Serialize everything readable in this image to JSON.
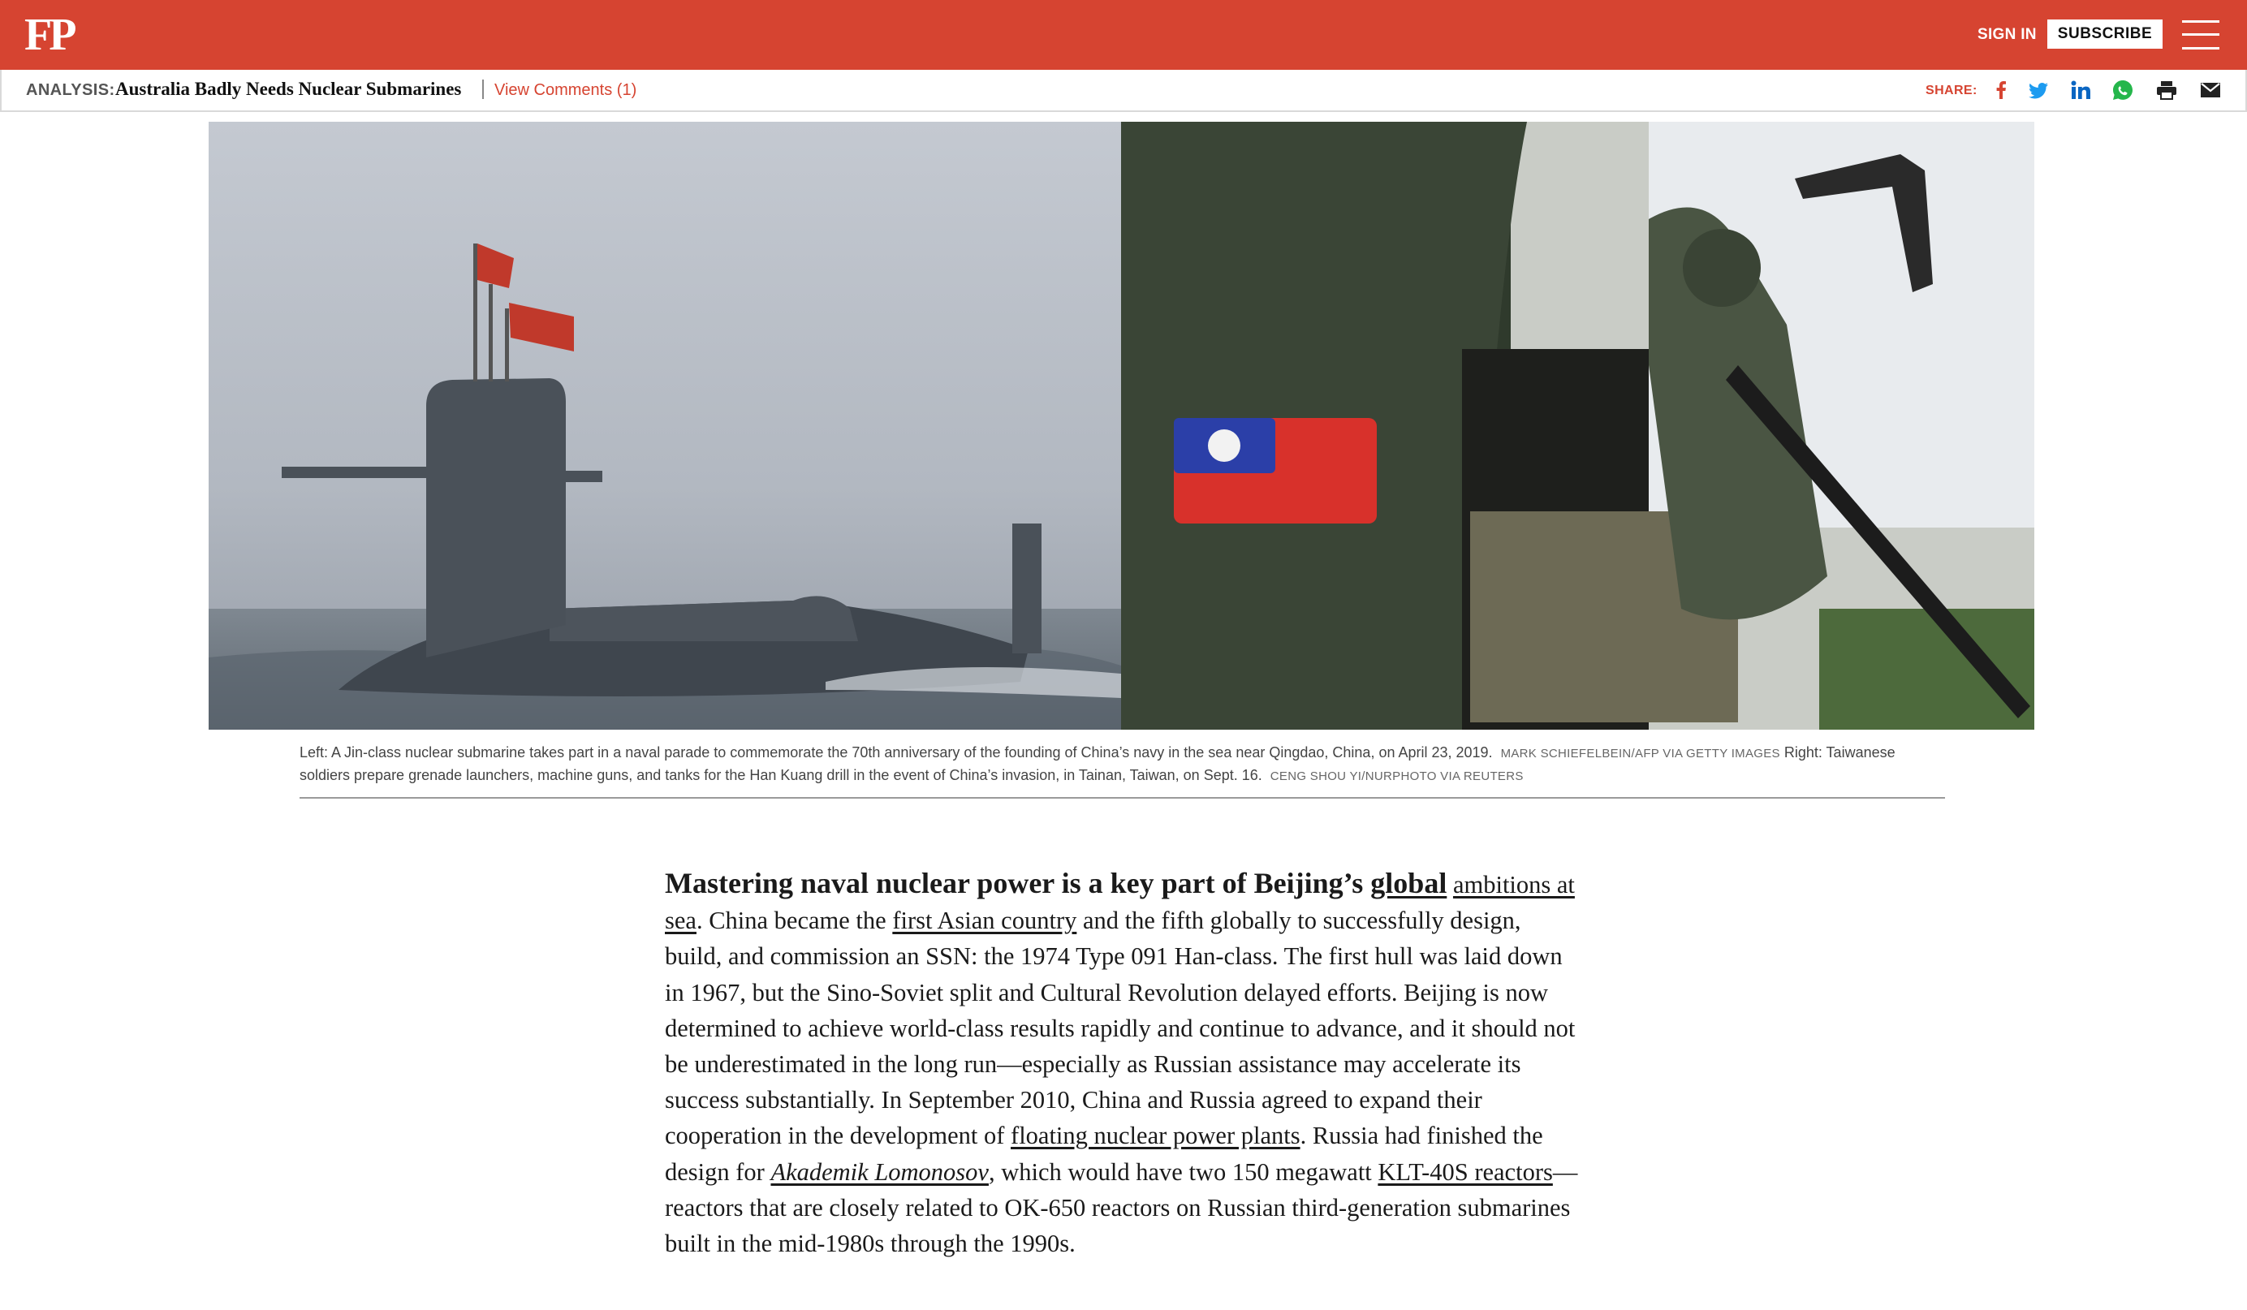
{
  "header": {
    "logo": "FP",
    "sign_in": "SIGN IN",
    "subscribe": "SUBSCRIBE",
    "brand_color": "#d64431"
  },
  "subbar": {
    "label": "ANALYSIS:",
    "title": "Australia Badly Needs Nuclear Submarines",
    "comments": "View Comments (1)",
    "share_label": "SHARE:",
    "share_icons": [
      "facebook-icon",
      "twitter-icon",
      "linkedin-icon",
      "whatsapp-icon",
      "print-icon",
      "email-icon"
    ]
  },
  "hero": {
    "left_image": "submarine-photo",
    "right_image": "soldiers-photo"
  },
  "caption": {
    "left_text": "Left: A Jin-class nuclear submarine takes part in a naval parade to commemorate the 70th anniversary of the founding of China’s navy in the sea near Qingdao, China, on April 23, 2019.",
    "left_credit": "MARK SCHIEFELBEIN/AFP VIA GETTY IMAGES",
    "right_text": "Right: Taiwanese soldiers prepare grenade launchers, machine guns, and tanks for the Han Kuang drill in the event of China’s invasion, in Tainan, Taiwan, on Sept. 16.",
    "right_credit": "CENG SHOU YI/NURPHOTO VIA REUTERS"
  },
  "article": {
    "lead": "Mastering naval nuclear power is a key part of Beijing’s ",
    "link_global": "global",
    "link_ambitions": "ambitions at sea",
    "t1": ". China became the ",
    "link_first_asian": "first Asian country",
    "t2": " and the fifth globally to successfully design, build, and commission an SSN: the 1974 Type 091 Han-class. The first hull was laid down in 1967, but the Sino-Soviet split and Cultural Revolution delayed efforts. Beijing is now determined to achieve world-class results rapidly and continue to advance, and it should not be underestimated in the long run—especially as Russian assistance may accelerate its success substantially. In September 2010, China and Russia agreed to expand their cooperation in the development of ",
    "link_floating": "floating nuclear power plants",
    "t3": ". Russia had finished the design for ",
    "link_akademik": "Akademik Lomonosov",
    "t4": ", which would have two 150 megawatt ",
    "link_klt": "KLT-40S reactors",
    "t5": "—reactors that are closely related to OK-650 reactors on Russian third-generation submarines built in the mid-1980s through the 1990s."
  }
}
